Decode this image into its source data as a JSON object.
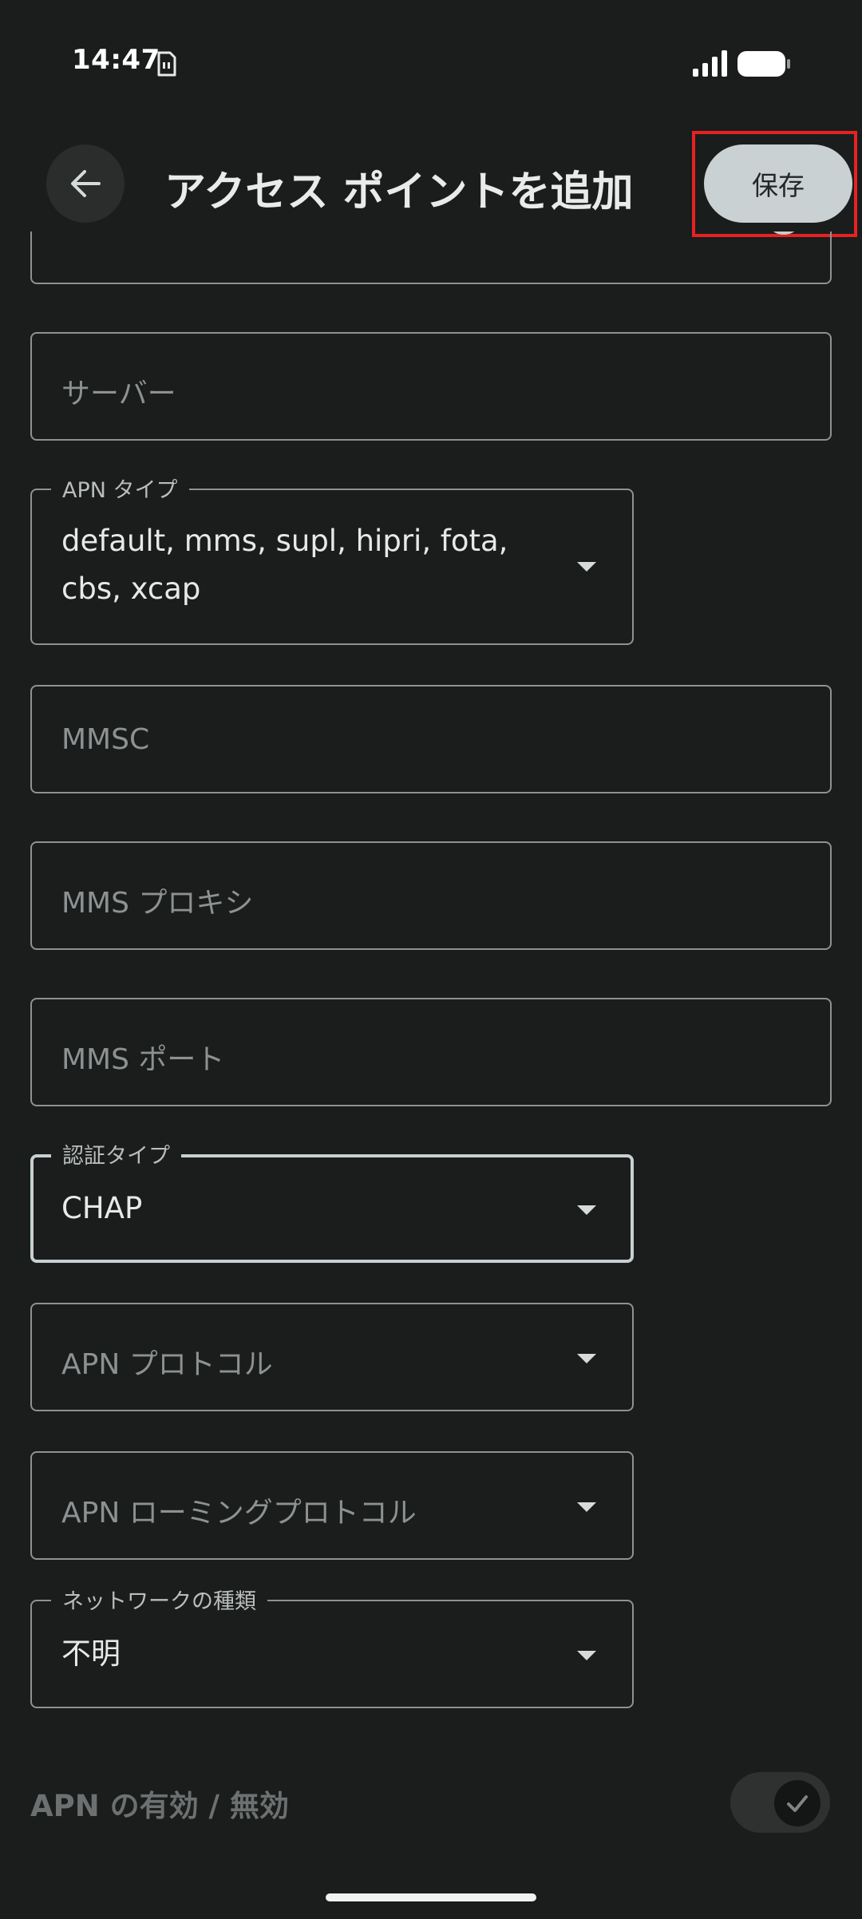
{
  "status_bar": {
    "time": "14:47"
  },
  "app_bar": {
    "title": "アクセス ポイントを追加",
    "save_label": "保存"
  },
  "form": {
    "password_masked": "••••",
    "server_placeholder": "サーバー",
    "apn_type_label": "APN タイプ",
    "apn_type_value_line1": "default, mms, supl, hipri, fota,",
    "apn_type_value_line2": "cbs, xcap",
    "mmsc_placeholder": "MMSC",
    "mms_proxy_placeholder": "MMS プロキシ",
    "mms_port_placeholder": "MMS ポート",
    "auth_type_label": "認証タイプ",
    "auth_type_value": "CHAP",
    "apn_protocol_placeholder": "APN プロトコル",
    "apn_roaming_protocol_placeholder": "APN ローミングプロトコル",
    "network_type_label": "ネットワークの種類",
    "network_type_value": "不明",
    "apn_enable_label": "APN の有効 / 無効",
    "apn_enable_checked": true
  },
  "colors": {
    "background": "#1b1c1c",
    "save_button": "#c9d1d2",
    "highlight": "#e52222",
    "field_border": "#8d9292"
  },
  "icons": {
    "back": "arrow-left-icon",
    "sim": "sim-card-icon",
    "signal": "cell-signal-icon",
    "battery": "battery-icon",
    "dropdown": "caret-down-icon",
    "check": "check-icon",
    "visibility": "eye-icon"
  }
}
